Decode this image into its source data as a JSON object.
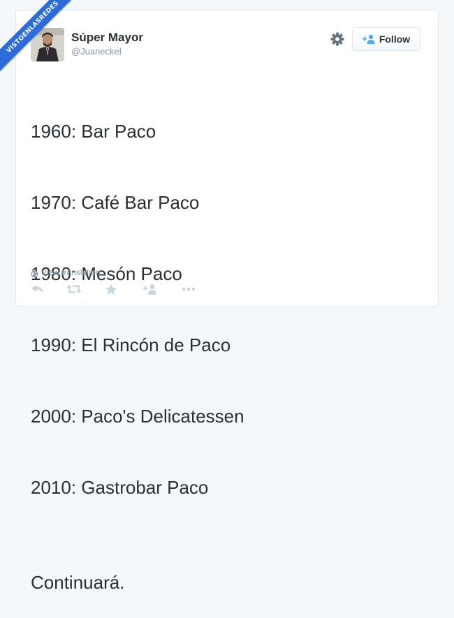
{
  "watermark": {
    "label": "VISTOENLASREDES"
  },
  "tweet": {
    "author": {
      "display_name": "Súper Mayor",
      "handle": "@Juaneckel",
      "avatar_icon": "profile-photo"
    },
    "follow_label": "Follow",
    "lines": [
      "1960: Bar Paco",
      "1970: Café Bar Paco",
      "1980: Mesón Paco",
      "1990: El Rincón de Paco",
      "2000: Paco's Delicatessen",
      "2010: Gastrobar Paco"
    ],
    "closing_line": "Continuará.",
    "translate_label": "View translation",
    "actions": [
      "reply-icon",
      "retweet-icon",
      "favorite-icon",
      "follow-icon",
      "more-icon"
    ],
    "colors": {
      "text": "#292f33",
      "muted": "#8899a6",
      "accent": "#55acee",
      "banner": "#2b6cd8"
    }
  }
}
